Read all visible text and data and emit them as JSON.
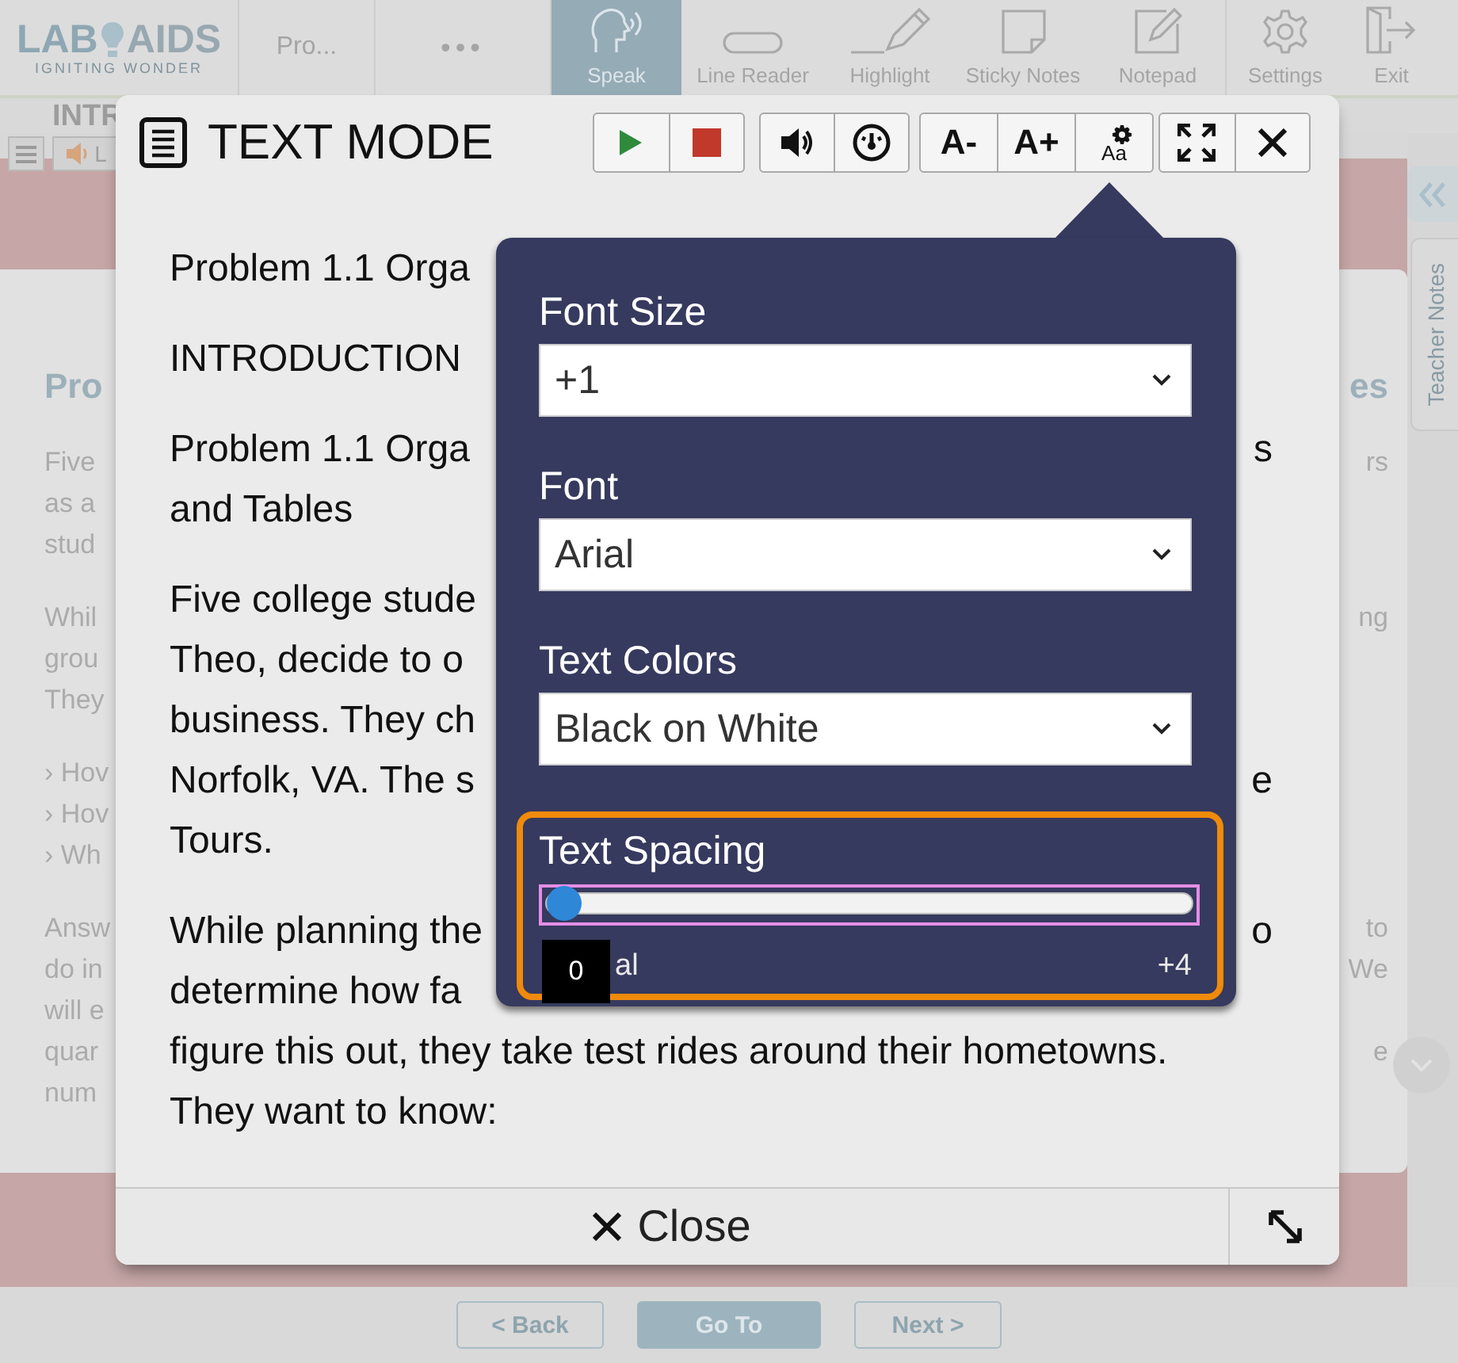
{
  "toolbar": {
    "logo": {
      "left": "LAB",
      "right": "AIDS",
      "tagline": "IGNITING WONDER"
    },
    "breadcrumb": "Pro...",
    "more": "•••",
    "tools": [
      {
        "label": "Speak",
        "selected": true
      },
      {
        "label": "Line Reader",
        "selected": false
      },
      {
        "label": "Highlight",
        "selected": false
      },
      {
        "label": "Sticky Notes",
        "selected": false
      },
      {
        "label": "Notepad",
        "selected": false
      },
      {
        "label": "Settings",
        "selected": false
      },
      {
        "label": "Exit",
        "selected": false
      }
    ]
  },
  "sub_bar": {
    "heading": "INTR",
    "reader_label": "L"
  },
  "page": {
    "paragraphs": [
      {
        "kind": "heading",
        "lines": [
          {
            "left": "Pro",
            "right": "es"
          }
        ]
      },
      {
        "kind": "text",
        "lines": [
          {
            "left": "Five",
            "right": "rs"
          },
          {
            "left": "as a"
          },
          {
            "left": "stud"
          }
        ]
      },
      {
        "kind": "text",
        "lines": [
          {
            "left": "Whil",
            "right": "ng"
          },
          {
            "left": "grou"
          },
          {
            "left": "They"
          }
        ]
      },
      {
        "kind": "list",
        "lines": [
          {
            "left": "› Hov"
          },
          {
            "left": "› Hov"
          },
          {
            "left": "› Wh"
          }
        ]
      },
      {
        "kind": "text",
        "lines": [
          {
            "left": "Answ",
            "right": "to"
          },
          {
            "left": "do in",
            "right": "We"
          },
          {
            "left": "will e"
          },
          {
            "left": "quar",
            "right": "e"
          },
          {
            "left": "num"
          }
        ]
      }
    ]
  },
  "sidebar": {
    "tab": "Teacher Notes"
  },
  "nav": [
    {
      "label": "< Back",
      "kind": "outline"
    },
    {
      "label": "Go To",
      "kind": "filled"
    },
    {
      "label": "Next >",
      "kind": "outline"
    }
  ],
  "text_mode": {
    "title": "TEXT MODE",
    "toolbar": [
      [
        {
          "kind": "play"
        },
        {
          "kind": "stop"
        }
      ],
      [
        {
          "kind": "volume"
        },
        {
          "kind": "speed"
        }
      ],
      [
        {
          "kind": "text",
          "label": "A-"
        },
        {
          "kind": "text",
          "label": "A+"
        },
        {
          "kind": "options",
          "label": "Aa"
        }
      ],
      [
        {
          "kind": "fullscreen"
        },
        {
          "kind": "close"
        }
      ]
    ],
    "paragraphs": [
      {
        "lines": [
          {
            "left": "Problem 1.1 Orga"
          }
        ]
      },
      {
        "lines": [
          {
            "left": "INTRODUCTION"
          }
        ]
      },
      {
        "lines": [
          {
            "left": "Problem 1.1 Orga",
            "right": "s"
          },
          {
            "left": "and Tables"
          }
        ]
      },
      {
        "lines": [
          {
            "left": "Five college stude"
          },
          {
            "left": "Theo, decide to o"
          },
          {
            "left": "business. They ch"
          },
          {
            "left": "Norfolk, VA. The s",
            "right": "e"
          },
          {
            "left": "Tours."
          }
        ]
      },
      {
        "lines": [
          {
            "left": "While planning the",
            "right": "o"
          },
          {
            "left": "determine how fa"
          },
          {
            "left": "figure this out, they take test rides around their hometowns."
          },
          {
            "left": "They want to know:"
          }
        ]
      }
    ],
    "close": "Close"
  },
  "popover": {
    "fields": [
      {
        "label": "Font Size",
        "value": "+1"
      },
      {
        "label": "Font",
        "value": "Arial"
      },
      {
        "label": "Text Colors",
        "value": "Black on White"
      }
    ],
    "spacing": {
      "label": "Text Spacing",
      "level": 0,
      "tooltip": "0",
      "min_label": "al",
      "max_label": "+4",
      "focused": true
    }
  }
}
